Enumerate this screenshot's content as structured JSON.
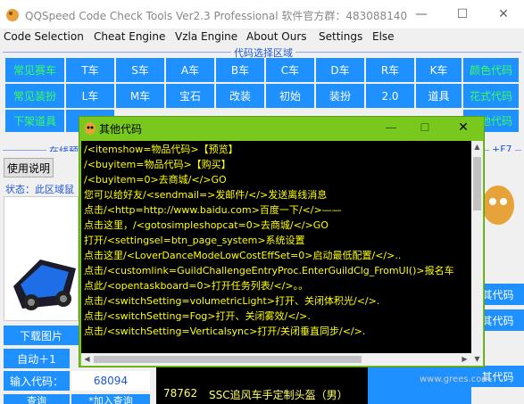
{
  "window": {
    "title": "QQSpeed Code Check Tools Ver2.3 Professional 软件官方群：483088140",
    "minimize_icon": "minimize-icon",
    "maximize_icon": "maximize-icon",
    "close_icon": "close-icon"
  },
  "menu": [
    "Code Selection",
    "Cheat Engine",
    "Vzla Engine",
    "About Ours",
    "Settings",
    "Else"
  ],
  "groupbox": {
    "title": "代码选择区域"
  },
  "grid": {
    "row1": [
      "常见赛车",
      "T车",
      "S车",
      "A车",
      "B车",
      "C车",
      "D车",
      "R车",
      "K车",
      "颜色代码"
    ],
    "row2": [
      "常见装扮",
      "L车",
      "M车",
      "宝石",
      "改装",
      "初始",
      "装扮",
      "2.0",
      "道具",
      "花式代码"
    ],
    "row3": [
      "下架道具",
      "其他代码"
    ]
  },
  "online_preview": {
    "label": "在线预",
    "suffix": "+F7"
  },
  "left_panel": {
    "help_button": "使用说明",
    "status": "状态：此区域鼠",
    "download_image": "下载图片",
    "auto_plus": "自动＋1",
    "input_code_label": "输入代码：",
    "input_code_value": "68094",
    "bottom_left": "查询",
    "bottom_mid": "*加入查询"
  },
  "right_panel": {
    "btn1": "其代码",
    "btn2": "其代码",
    "btn3": "其代码"
  },
  "list": {
    "row_code": "78762",
    "row_name": "SSC追风车手定制头盔（男）"
  },
  "popup": {
    "title": "其他代码",
    "lines": [
      "/<itemshow=物品代码>【预览】",
      "/<buyitem=物品代码>【购买】",
      "/<buyitem=0>去商城/</>GO",
      "您可以给好友/<sendmail=>发邮件/</>发送离线消息",
      "点击/<http=http://www.baidu.com>百度一下/</>——",
      "点击这里，/<gotosimpleshopcat=0>去商城/</>GO",
      "打开/<settingsel=btn_page_system>系统设置",
      "点击这里/<LoverDanceModeLowCostEffSet=0>启动最低配置/</>..",
      "点击/<customlink=GuildChallengeEntryProc.EnterGuildClg_FromUI()>报名车",
      "点此/<opentaskboard=0>打开任务列表/</>。。",
      "点击/<switchSetting=volumetricLight>打开、关闭体积光/</>.",
      "点击/<switchSetting=Fog>打开、关闭雾效/</>.",
      "点击/<switchSetting=Verticalsync>打开/关闭垂直同步/</>."
    ]
  },
  "watermark": "www.grees.com"
}
